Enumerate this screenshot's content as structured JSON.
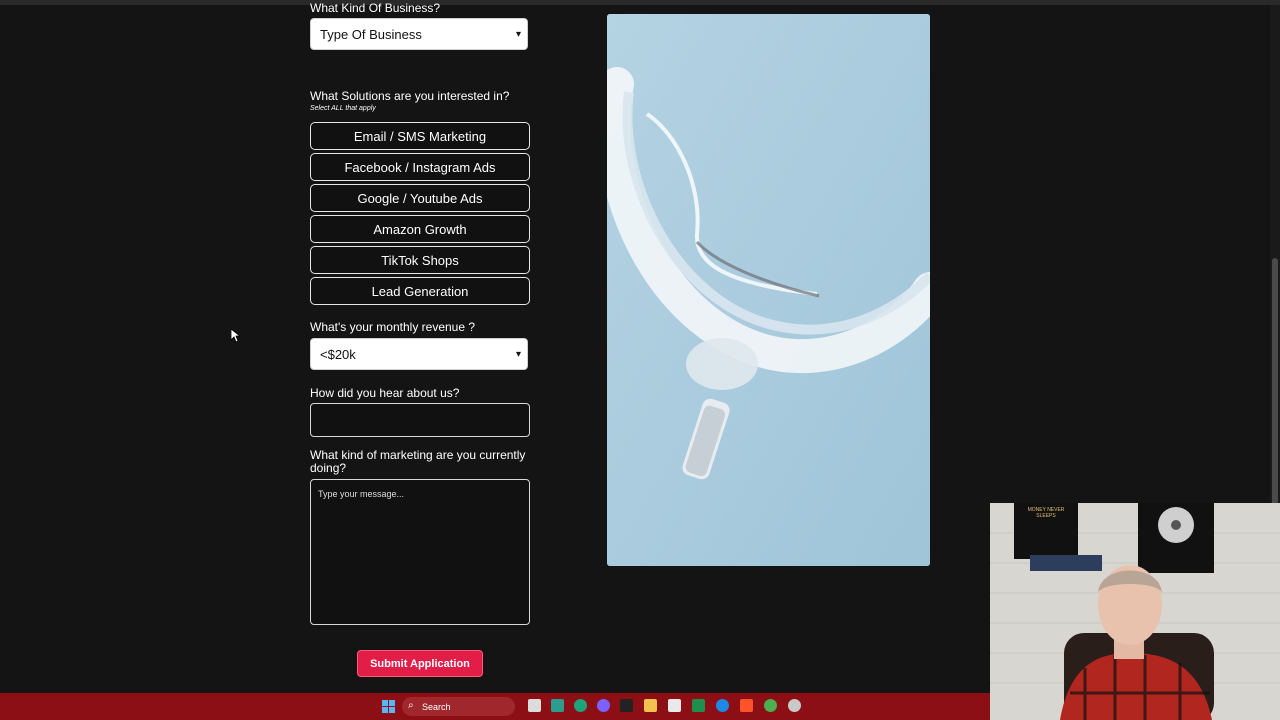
{
  "form": {
    "business_label": "What Kind Of Business?",
    "business_select": "Type Of Business",
    "solutions_label": "What Solutions are you interested in?",
    "solutions_hint": "Select ALL that apply",
    "solutions": [
      "Email / SMS Marketing",
      "Facebook / Instagram Ads",
      "Google / Youtube Ads",
      "Amazon Growth",
      "TikTok Shops",
      "Lead Generation"
    ],
    "revenue_label": "What's your monthly revenue ?",
    "revenue_select": "<$20k",
    "hear_label": "How did you hear about us?",
    "hear_value": "",
    "marketing_label": "What kind of marketing are you currently doing?",
    "marketing_placeholder": "Type your message...",
    "submit_label": "Submit Application"
  },
  "taskbar": {
    "search_placeholder": "Search"
  },
  "webcam": {
    "poster_text": "MONEY NEVER SLEEPS"
  },
  "colors": {
    "background": "#141414",
    "accent": "#e11d48",
    "taskbar": "#8b0f14",
    "promo_bg": "#a9cbdc"
  }
}
